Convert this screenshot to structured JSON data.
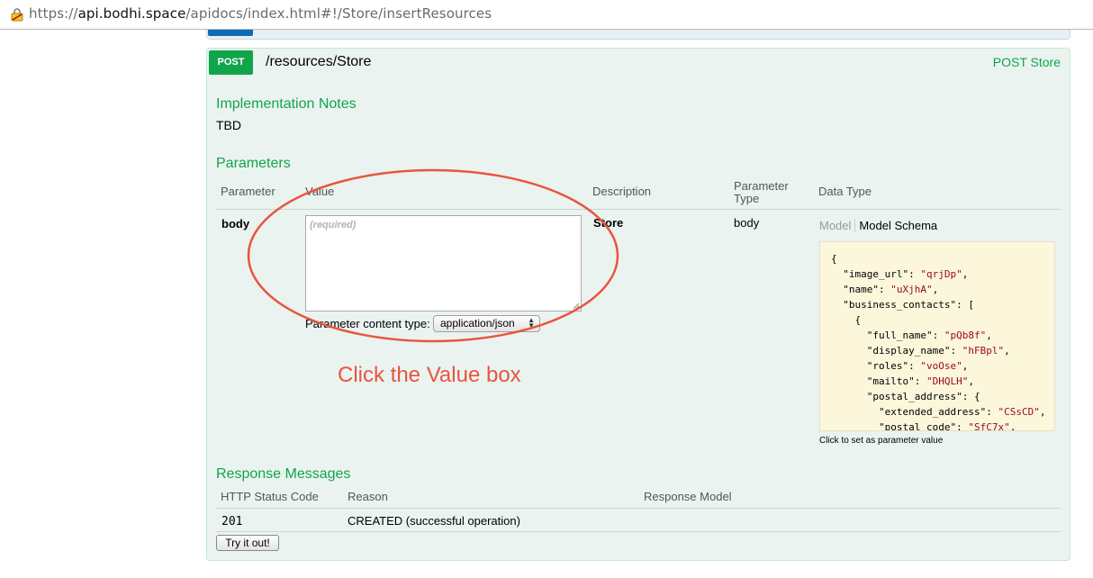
{
  "browser": {
    "url_prefix": "https://",
    "url_host": "api.bodhi.space",
    "url_path": "/apidocs/index.html#!/Store/insertResources"
  },
  "operation": {
    "method": "POST",
    "path": "/resources/Store",
    "summary": "POST Store",
    "implementation_notes_title": "Implementation Notes",
    "implementation_notes": "TBD",
    "parameters_title": "Parameters",
    "parameters_headers": {
      "parameter": "Parameter",
      "value": "Value",
      "description": "Description",
      "parameter_type_line1": "Parameter",
      "parameter_type_line2": "Type",
      "data_type": "Data Type"
    },
    "parameter": {
      "name": "body",
      "value_placeholder": "(required)",
      "content_type_label": "Parameter content type:",
      "content_type_selected": "application/json",
      "description": "Store",
      "type": "body",
      "model_tab": "Model",
      "model_schema_tab": "Model Schema",
      "schema_hint": "Click to set as parameter value"
    },
    "schema_lines": [
      {
        "indent": "",
        "key": "",
        "value": "",
        "punct": "{"
      },
      {
        "indent": "  ",
        "key": "\"image_url\"",
        "value": "\"qrjDp\"",
        "punct": ","
      },
      {
        "indent": "  ",
        "key": "\"name\"",
        "value": "\"uXjhA\"",
        "punct": ","
      },
      {
        "indent": "  ",
        "key": "\"business_contacts\"",
        "value": "",
        "punct": ": ["
      },
      {
        "indent": "    ",
        "key": "",
        "value": "",
        "punct": "{"
      },
      {
        "indent": "      ",
        "key": "\"full_name\"",
        "value": "\"pQb8f\"",
        "punct": ","
      },
      {
        "indent": "      ",
        "key": "\"display_name\"",
        "value": "\"hFBpl\"",
        "punct": ","
      },
      {
        "indent": "      ",
        "key": "\"roles\"",
        "value": "\"voOse\"",
        "punct": ","
      },
      {
        "indent": "      ",
        "key": "\"mailto\"",
        "value": "\"DHQLH\"",
        "punct": ","
      },
      {
        "indent": "      ",
        "key": "\"postal_address\"",
        "value": "",
        "punct": ": {"
      },
      {
        "indent": "        ",
        "key": "\"extended_address\"",
        "value": "\"CSsCD\"",
        "punct": ","
      },
      {
        "indent": "        ",
        "key": "\"postal_code\"",
        "value": "\"SfC7x\"",
        "punct": ","
      }
    ],
    "response_title": "Response Messages",
    "response_headers": {
      "status_code": "HTTP Status Code",
      "reason": "Reason",
      "model": "Response Model"
    },
    "responses": [
      {
        "code": "201",
        "reason": "CREATED (successful operation)"
      }
    ],
    "try_button": "Try it out!"
  },
  "annotation": {
    "text": "Click the Value box",
    "color": "#e8553f"
  },
  "colors": {
    "post_green": "#10a54a",
    "panel_bg": "#ebf3f0",
    "schema_bg": "#fcf6db"
  }
}
